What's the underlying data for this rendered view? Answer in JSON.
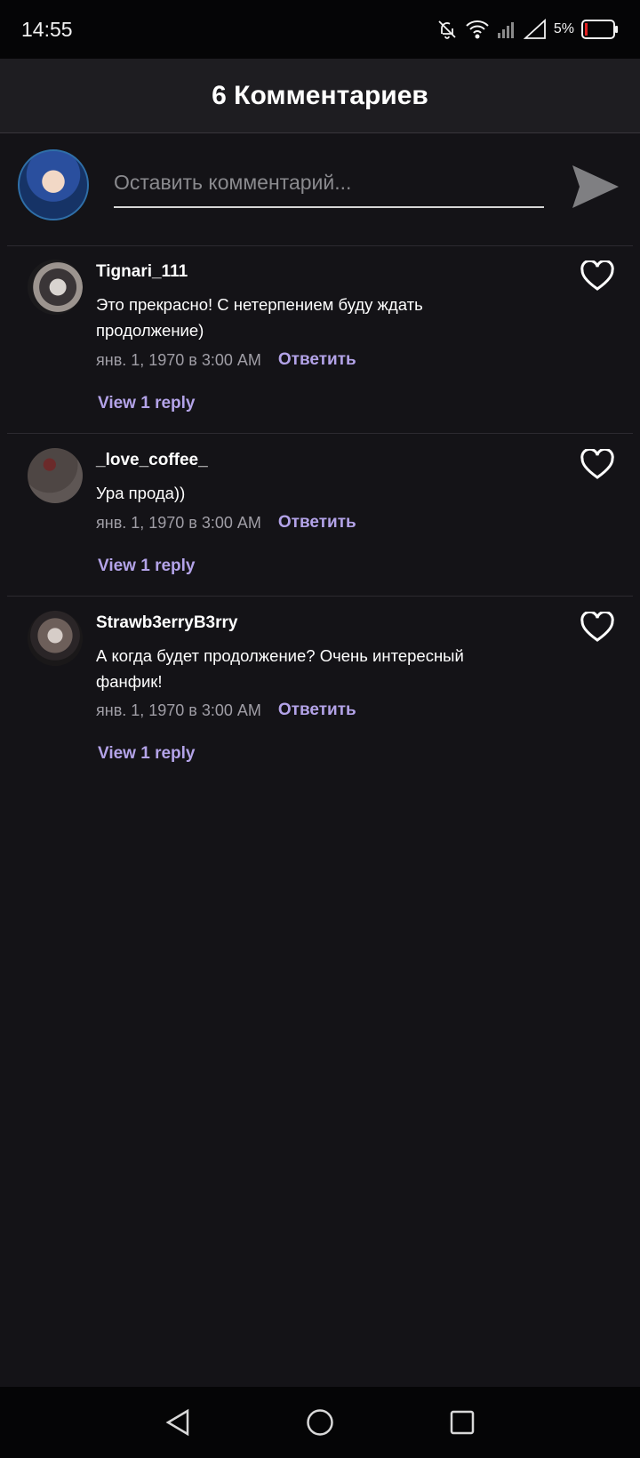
{
  "status_bar": {
    "time": "14:55",
    "battery": "5%",
    "icons": [
      "bell-off-icon",
      "wifi-icon",
      "signal-icon",
      "signal-empty-icon",
      "battery-low-icon"
    ]
  },
  "header": {
    "title": "6 Комментариев"
  },
  "composer": {
    "placeholder": "Оставить комментарий...",
    "send_icon": "send-icon"
  },
  "comments": [
    {
      "username": "Tignari_111",
      "text": "Это прекрасно! С нетерпением буду ждать продолжение)",
      "date": "янв. 1, 1970 в 3:00 AM",
      "reply_label": "Ответить",
      "view_replies": "View 1 reply"
    },
    {
      "username": "_love_coffee_",
      "text": "Ура прода))",
      "date": "янв. 1, 1970 в 3:00 AM",
      "reply_label": "Ответить",
      "view_replies": "View 1 reply"
    },
    {
      "username": "Strawb3erryB3rry",
      "text": "А когда будет продолжение?  Очень интересный фанфик!",
      "date": "янв. 1, 1970 в 3:00 AM",
      "reply_label": "Ответить",
      "view_replies": "View 1 reply"
    }
  ],
  "colors": {
    "background": "#141317",
    "header": "#1e1d21",
    "accent": "#b3a3e8",
    "muted_text": "#a09ea6"
  },
  "nav_bar": {
    "icons": [
      "back-icon",
      "home-icon",
      "recents-icon"
    ]
  }
}
